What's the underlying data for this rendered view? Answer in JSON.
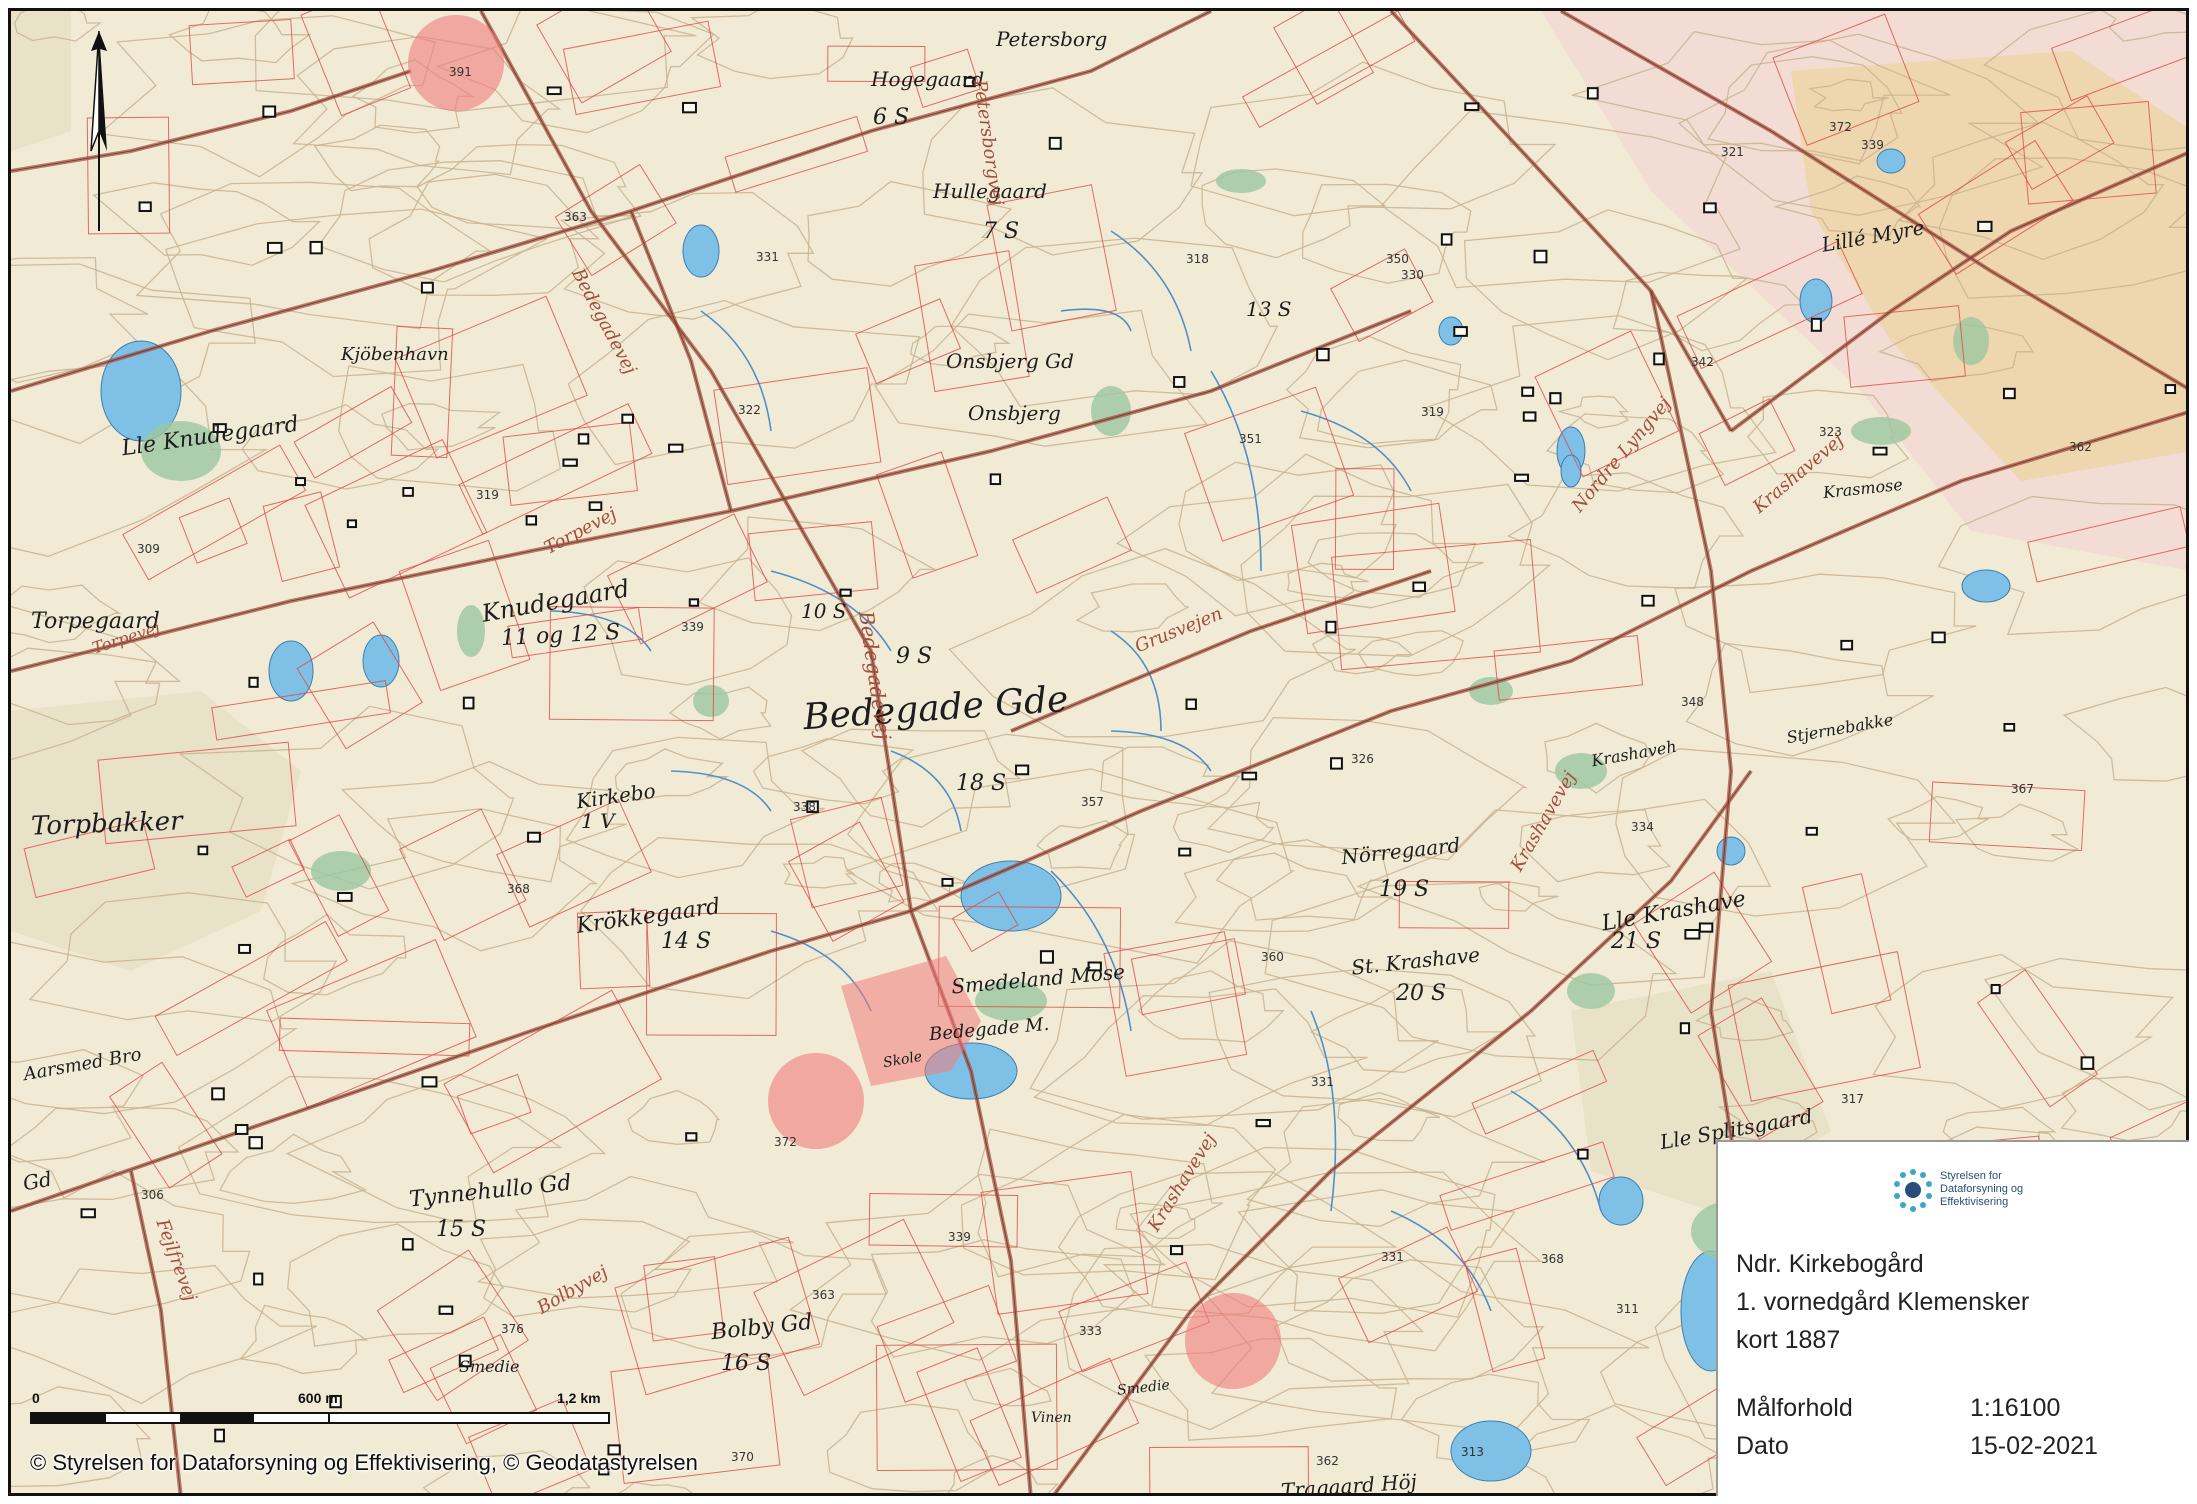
{
  "map": {
    "colors": {
      "paper": "#f1ebd6",
      "contour": "#c9b391",
      "parcel": "#e04848",
      "road": "#b0503e",
      "water": "#7ec0e6",
      "forest": "#9cc79f",
      "highlight": "#f07b7b"
    },
    "places": [
      {
        "name": "Petersborg",
        "size": 20
      },
      {
        "name": "Hogegaard",
        "size": 20
      },
      {
        "name": "6 S",
        "size": 22
      },
      {
        "name": "Hullegaard",
        "size": 20
      },
      {
        "name": "7 S",
        "size": 22
      },
      {
        "name": "Kjöbenhavn",
        "size": 18
      },
      {
        "name": "Onsbjerg Gd",
        "size": 20
      },
      {
        "name": "Onsbjerg",
        "size": 20
      },
      {
        "name": "Lle Knudegaard",
        "size": 22
      },
      {
        "name": "Lillé Myre",
        "size": 20
      },
      {
        "name": "Torpegaard",
        "size": 22
      },
      {
        "name": "13 S",
        "size": 20
      },
      {
        "name": "Knudegaard",
        "size": 24
      },
      {
        "name": "11 og 12 S",
        "size": 22
      },
      {
        "name": "10 S",
        "size": 20
      },
      {
        "name": "9 S",
        "size": 22
      },
      {
        "name": "Bedegade Gde",
        "size": 36
      },
      {
        "name": "18 S",
        "size": 22
      },
      {
        "name": "Krashaveh",
        "size": 16
      },
      {
        "name": "Stjernebakke",
        "size": 16
      },
      {
        "name": "Torpbakker",
        "size": 26
      },
      {
        "name": "Kirkebo",
        "size": 20
      },
      {
        "name": "1 V",
        "size": 20
      },
      {
        "name": "Nörregaard",
        "size": 20
      },
      {
        "name": "19 S",
        "size": 22
      },
      {
        "name": "Krökkegaard",
        "size": 22
      },
      {
        "name": "14 S",
        "size": 22
      },
      {
        "name": "St. Krashave",
        "size": 20
      },
      {
        "name": "20 S",
        "size": 22
      },
      {
        "name": "Lle Krashave",
        "size": 22
      },
      {
        "name": "21 S",
        "size": 22
      },
      {
        "name": "Smedeland Mose",
        "size": 20
      },
      {
        "name": "Bedegade M.",
        "size": 18
      },
      {
        "name": "Skole",
        "size": 14
      },
      {
        "name": "Aarsmed Bro",
        "size": 18
      },
      {
        "name": "Tynnehullo Gd",
        "size": 22
      },
      {
        "name": "15 S",
        "size": 22
      },
      {
        "name": "Lle Splitsgaard",
        "size": 20
      },
      {
        "name": "Bolby Gd",
        "size": 22
      },
      {
        "name": "16 S",
        "size": 22
      },
      {
        "name": "Smedie",
        "size": 16
      },
      {
        "name": "Smedie",
        "size": 14
      },
      {
        "name": "Vinen",
        "size": 14
      },
      {
        "name": "Tragaard Höj",
        "size": 20
      },
      {
        "name": "Krasmose",
        "size": 16
      },
      {
        "name": "Gd",
        "size": 20
      }
    ],
    "roads": [
      {
        "name": "Petersborgvej",
        "size": 18
      },
      {
        "name": "Bedegadevej",
        "size": 18
      },
      {
        "name": "Bedegadevej",
        "size": 20
      },
      {
        "name": "Torpevej",
        "size": 18
      },
      {
        "name": "Torpevej",
        "size": 16
      },
      {
        "name": "Grusvejen",
        "size": 18
      },
      {
        "name": "Nordre Lyngvej",
        "size": 18
      },
      {
        "name": "Krashavevej",
        "size": 18
      },
      {
        "name": "Krashavevej",
        "size": 18
      },
      {
        "name": "Krashavevej",
        "size": 18
      },
      {
        "name": "Bolbyvej",
        "size": 18
      },
      {
        "name": "Fejlfrevej",
        "size": 18
      }
    ],
    "heights": [
      "391",
      "363",
      "331",
      "318",
      "350",
      "321",
      "339",
      "330",
      "319",
      "342",
      "322",
      "372",
      "351",
      "323",
      "362",
      "357",
      "339",
      "348",
      "338",
      "326",
      "367",
      "368",
      "360",
      "331",
      "334",
      "331",
      "372",
      "339",
      "363",
      "333",
      "370",
      "362",
      "313",
      "311",
      "317",
      "306",
      "376",
      "368",
      "319",
      "309"
    ]
  },
  "compass": {
    "label": "N"
  },
  "scalebar": {
    "labels": [
      "0",
      "600 m",
      "1,2 km"
    ]
  },
  "copyright": "© Styrelsen for Dataforsyning og Effektivisering, © Geodatastyrelsen",
  "info": {
    "logo_text": "Styrelsen for\nDataforsyning og\nEffektivisering",
    "title": "Ndr. Kirkebogård",
    "subtitle": "1. vornedgård Klemensker",
    "map_year": "kort 1887",
    "scale_label": "Målforhold",
    "scale_value": "1:16100",
    "date_label": "Dato",
    "date_value": "15-02-2021"
  }
}
